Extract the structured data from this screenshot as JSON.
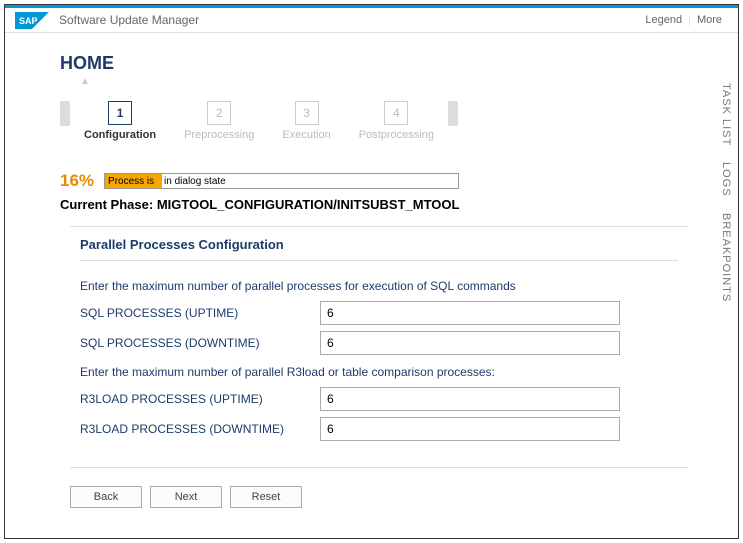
{
  "header": {
    "app_title": "Software Update Manager",
    "legend": "Legend",
    "more": "More"
  },
  "side_tabs": [
    "TASK LIST",
    "LOGS",
    "BREAKPOINTS"
  ],
  "home": {
    "title": "HOME"
  },
  "roadmap": {
    "steps": [
      {
        "num": "1",
        "label": "Configuration",
        "active": true
      },
      {
        "num": "2",
        "label": "Preprocessing",
        "active": false
      },
      {
        "num": "3",
        "label": "Execution",
        "active": false
      },
      {
        "num": "4",
        "label": "Postprocessing",
        "active": false
      }
    ]
  },
  "progress": {
    "percent": "16%",
    "status_highlight": "Process is",
    "status_rest": "in dialog state"
  },
  "phase": {
    "label": "Current Phase:",
    "value": "MIGTOOL_CONFIGURATION/INITSUBST_MTOOL"
  },
  "section": {
    "title": "Parallel Processes Configuration",
    "hint1": "Enter the maximum number of parallel processes for execution of SQL commands",
    "sql_uptime_label": "SQL PROCESSES (UPTIME)",
    "sql_uptime_value": "6",
    "sql_downtime_label": "SQL PROCESSES (DOWNTIME)",
    "sql_downtime_value": "6",
    "hint2": "Enter the maximum number of parallel R3load or table comparison processes:",
    "r3_uptime_label": "R3LOAD PROCESSES (UPTIME)",
    "r3_uptime_value": "6",
    "r3_downtime_label": "R3LOAD PROCESSES (DOWNTIME)",
    "r3_downtime_value": "6"
  },
  "buttons": {
    "back": "Back",
    "next": "Next",
    "reset": "Reset"
  }
}
